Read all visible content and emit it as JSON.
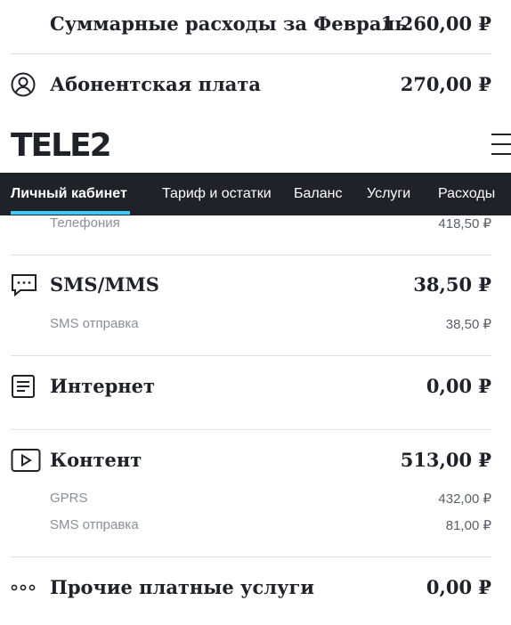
{
  "summary": {
    "title": "Суммарные расходы за Февраль",
    "amount": "1 260,00 ₽"
  },
  "subscription": {
    "title": "Абонентская плата",
    "amount": "270,00 ₽"
  },
  "header": {
    "logo": "TELE2"
  },
  "nav": {
    "items": [
      {
        "label": "Личный кабинет",
        "active": true
      },
      {
        "label": "Тариф и остатки"
      },
      {
        "label": "Баланс"
      },
      {
        "label": "Услуги"
      },
      {
        "label": "Расходы"
      }
    ]
  },
  "telephony_partial": {
    "label": "Телефония",
    "amount": "418,50 ₽"
  },
  "sections": [
    {
      "icon": "chat-icon",
      "title": "SMS/MMS",
      "amount": "38,50 ₽",
      "items": [
        {
          "label": "SMS отправка",
          "amount": "38,50 ₽"
        }
      ]
    },
    {
      "icon": "document-icon",
      "title": "Интернет",
      "amount": "0,00 ₽",
      "items": []
    },
    {
      "icon": "play-icon",
      "title": "Контент",
      "amount": "513,00 ₽",
      "items": [
        {
          "label": "GPRS",
          "amount": "432,00 ₽"
        },
        {
          "label": "SMS отправка",
          "amount": "81,00 ₽"
        }
      ]
    },
    {
      "icon": "more-icon",
      "title": "Прочие платные услуги",
      "amount": "0,00 ₽",
      "items": []
    }
  ]
}
